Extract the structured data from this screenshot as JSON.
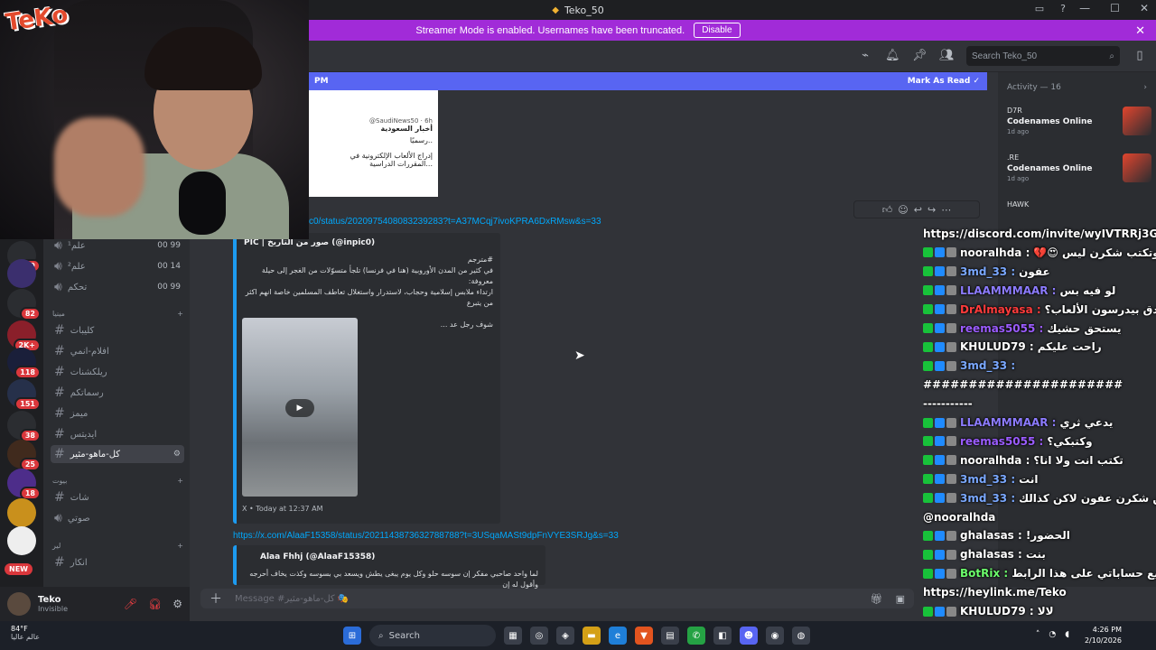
{
  "window": {
    "title": "Teko_50",
    "controls": [
      "—",
      "☐",
      "✕"
    ]
  },
  "banner": {
    "text": "Streamer Mode is enabled. Usernames have been truncated.",
    "button": "Disable"
  },
  "header": {
    "search_placeholder": "Search Teko_50"
  },
  "chat": {
    "new_messages_time": "PM",
    "mark_as_read": "Mark As Read",
    "top_embed": {
      "handle": "@SaudiNews50 · 6h",
      "name": "أخبار السعودية",
      "line1": "رسميًا..",
      "line2": "إدراج الألعاب الإلكترونية في",
      "line3": "المقررات الدراسية..."
    },
    "link1": "c0/status/2020975408083239283?t=A37MCqj7ivoKPRA6DxRMsw&s=33",
    "embed1": {
      "author": "PIC | صور من التاريخ (@inpic0)",
      "line1": "#مترجم",
      "line2": "في كثير من المدن الأوروبية (هنا في فرنسا) تلجأ متسوّلات من الغجر إلى حيلة معروفة:",
      "line3": "ارتداء ملابس إسلامية وحجاب، لاستدرار واستغلال تعاطف المسلمين خاصة انهم اكثر من يتبرع",
      "line4": "شوف رجل عد ...",
      "footer": "X • Today at 12:37 AM"
    },
    "link2": "https://x.com/AlaaF15358/status/2021143873632788788?t=3USqaMASt9dpFnVYE3SRJg&s=33",
    "embed2": {
      "author": "Alaa Fhhj (@AlaaF15358)",
      "line1": "لما واحد صاحبي مفكر إن سوسه حلو وكل يوم يبغى يطش ويسعد بي بسوسه وكذت يخاف أحرجه وأقول له إن"
    },
    "composer_placeholder": "Message #كل-ماهو-مثير 🎭"
  },
  "sidebar": {
    "voice": [
      {
        "name": "علم¹",
        "count": "00",
        "limit": "99"
      },
      {
        "name": "علم²",
        "count": "00",
        "limit": "14"
      },
      {
        "name": "تحكم",
        "count": "00",
        "limit": "99"
      }
    ],
    "cat1": "مينيا",
    "channels": [
      "كليبات",
      "افلام-انمي",
      "ريلكشنات",
      "رسماتكم",
      "ميمز",
      "ايديتس",
      "كل-ماهو-مثير"
    ],
    "cat2": "بيوت",
    "channels2": [
      "شات",
      "صوتي"
    ],
    "cat3": "لير",
    "channels3": [
      "انكار"
    ]
  },
  "rail": {
    "badges": [
      "19",
      "82",
      "2K+",
      "118",
      "151",
      "38",
      "25",
      "18"
    ],
    "new": "NEW"
  },
  "user": {
    "name": "Teko",
    "status": "Invisible"
  },
  "activity": {
    "title": "Activity — 16",
    "items": [
      {
        "who": "D7R",
        "game": "Codenames Online",
        "when": "1d ago"
      },
      {
        "who": ".RE",
        "game": "Codenames Online",
        "when": "1d ago"
      },
      {
        "who": "HAWK",
        "game": "",
        "when": ""
      }
    ]
  },
  "overlay_chat": [
    {
      "user": "https://discord.com/invite/wyIVTRRj3G",
      "msg": "",
      "color": "#ffffff"
    },
    {
      "user": "nooralhda :",
      "msg": "اها وتكتب شكرن ليس 😍💔",
      "color": "#ffffff"
    },
    {
      "user": "3md_33 :",
      "msg": "عفون",
      "color": "#7aa8ff"
    },
    {
      "user": "LLAAMMMAAR :",
      "msg": "لو فيه بس",
      "color": "#8c7bff"
    },
    {
      "user": "DrAlmayasa :",
      "msg": "الحين صدق بيدرسون الألعاب؟",
      "color": "#ff3b3b"
    },
    {
      "user": "reemas5055 :",
      "msg": "يستحق حشيك",
      "color": "#9b5cff"
    },
    {
      "user": "KHULUD79 :",
      "msg": "راحت عليكم",
      "color": "#ffffff"
    },
    {
      "user": "3md_33 :",
      "msg": "",
      "color": "#7aa8ff"
    },
    {
      "user": "######################",
      "msg": "",
      "color": "#ffffff"
    },
    {
      "user": "-----------",
      "msg": "",
      "color": "#ffffff"
    },
    {
      "user": "LLAAMMMAAR :",
      "msg": "يدعي ثري",
      "color": "#8c7bff"
    },
    {
      "user": "reemas5055 :",
      "msg": "وكتبكي؟",
      "color": "#9b5cff"
    },
    {
      "user": "nooralhda :",
      "msg": "تكتب انت ولا انا؟",
      "color": "#ffffff"
    },
    {
      "user": "3md_33 :",
      "msg": "انت",
      "color": "#7aa8ff"
    },
    {
      "user": "3md_33 :",
      "msg": "طبعن ايضن شكرن عفون لاكن كذالك",
      "color": "#7aa8ff"
    },
    {
      "user": "@nooralhda",
      "msg": "",
      "color": "#ffffff"
    },
    {
      "user": "ghalasas :",
      "msg": "الحضور!",
      "color": "#ffffff"
    },
    {
      "user": "ghalasas :",
      "msg": "بنت",
      "color": "#ffffff"
    },
    {
      "user": "BotRix :",
      "msg": "جميع حساباتي على هذا الرابط",
      "color": "#6cff6c"
    },
    {
      "user": "https://heylink.me/Teko",
      "msg": "",
      "color": "#ffffff"
    },
    {
      "user": "KHULUD79 :",
      "msg": "لالا",
      "color": "#ffffff"
    }
  ],
  "cam": {
    "logo": "TeKo"
  },
  "taskbar": {
    "temp": "84°F",
    "weather": "عالم عاليا",
    "search": "Search",
    "time": "4:26 PM",
    "date": "2/10/2026"
  }
}
